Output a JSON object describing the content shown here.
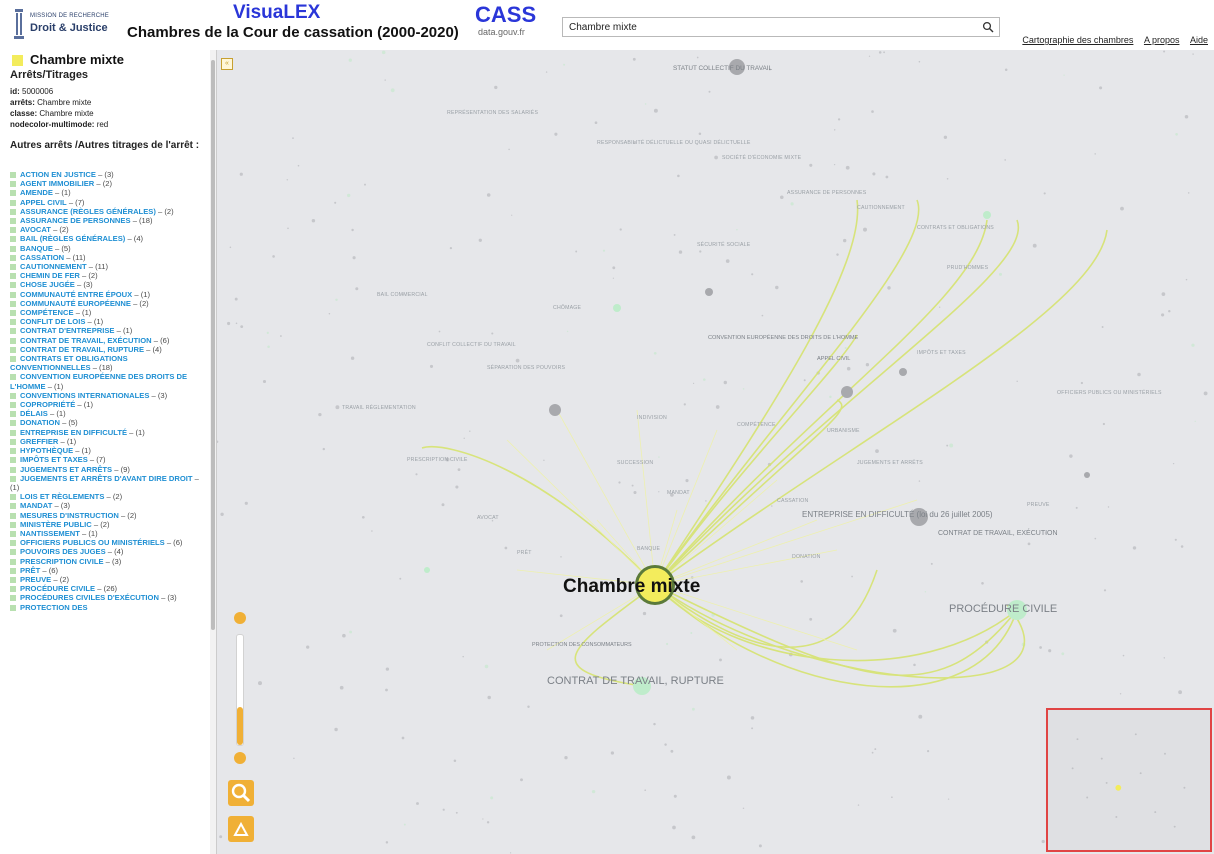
{
  "header": {
    "logo_line1": "MISSION DE RECHERCHE",
    "logo_line2": "Droit & Justice",
    "app_name": "VisuaLEX",
    "app_subtitle": "Chambres de la Cour de cassation (2000-2020)",
    "cass_title": "CASS",
    "cass_sub": "data.gouv.fr",
    "search": {
      "value": "Chambre mixte",
      "placeholder": ""
    },
    "links": [
      "Cartographie des chambres",
      "A propos",
      "Aide"
    ]
  },
  "sidebar": {
    "selected_name": "Chambre mixte",
    "section_title": "Arrêts/Titrages",
    "meta": [
      {
        "key": "id:",
        "value": "5000006"
      },
      {
        "key": "arrêts:",
        "value": "Chambre mixte"
      },
      {
        "key": "classe:",
        "value": "Chambre mixte"
      },
      {
        "key": "nodecolor-multimode:",
        "value": "red"
      }
    ],
    "other_title": "Autres arrêts /Autres titrages de l'arrêt :",
    "items": [
      {
        "label": "ACTION EN JUSTICE",
        "count": "– (3)"
      },
      {
        "label": "AGENT IMMOBILIER",
        "count": "– (2)"
      },
      {
        "label": "AMENDE",
        "count": "– (1)"
      },
      {
        "label": "APPEL CIVIL",
        "count": "– (7)"
      },
      {
        "label": "ASSURANCE (RÈGLES GÉNÉRALES)",
        "count": "– (2)"
      },
      {
        "label": "ASSURANCE DE PERSONNES",
        "count": "– (18)"
      },
      {
        "label": "AVOCAT",
        "count": "– (2)"
      },
      {
        "label": "BAIL (RÈGLES GÉNÉRALES)",
        "count": "– (4)"
      },
      {
        "label": "BANQUE",
        "count": "– (5)"
      },
      {
        "label": "CASSATION",
        "count": "– (11)"
      },
      {
        "label": "CAUTIONNEMENT",
        "count": "– (11)"
      },
      {
        "label": "CHEMIN DE FER",
        "count": "– (2)"
      },
      {
        "label": "CHOSE JUGÉE",
        "count": "– (3)"
      },
      {
        "label": "COMMUNAUTÉ ENTRE ÉPOUX",
        "count": "– (1)"
      },
      {
        "label": "COMMUNAUTÉ EUROPÉENNE",
        "count": "– (2)"
      },
      {
        "label": "COMPÉTENCE",
        "count": "– (1)"
      },
      {
        "label": "CONFLIT DE LOIS",
        "count": "– (1)"
      },
      {
        "label": "CONTRAT D'ENTREPRISE",
        "count": "– (1)"
      },
      {
        "label": "CONTRAT DE TRAVAIL, EXÉCUTION",
        "count": "– (6)"
      },
      {
        "label": "CONTRAT DE TRAVAIL, RUPTURE",
        "count": "– (4)"
      },
      {
        "label": "CONTRATS ET OBLIGATIONS CONVENTIONNELLES",
        "count": "– (18)"
      },
      {
        "label": "CONVENTION EUROPÉENNE DES DROITS DE L'HOMME",
        "count": "– (1)"
      },
      {
        "label": "CONVENTIONS INTERNATIONALES",
        "count": "– (3)"
      },
      {
        "label": "COPROPRIÉTÉ",
        "count": "– (1)"
      },
      {
        "label": "DÉLAIS",
        "count": "– (1)"
      },
      {
        "label": "DONATION",
        "count": "– (5)"
      },
      {
        "label": "ENTREPRISE EN DIFFICULTÉ",
        "count": "– (1)"
      },
      {
        "label": "GREFFIER",
        "count": "– (1)"
      },
      {
        "label": "HYPOTHÈQUE",
        "count": "– (1)"
      },
      {
        "label": "IMPÔTS ET TAXES",
        "count": "– (7)"
      },
      {
        "label": "JUGEMENTS ET ARRÊTS",
        "count": "– (9)"
      },
      {
        "label": "JUGEMENTS ET ARRÊTS D'AVANT DIRE DROIT",
        "count": "– (1)"
      },
      {
        "label": "LOIS ET RÈGLEMENTS",
        "count": "– (2)"
      },
      {
        "label": "MANDAT",
        "count": "– (3)"
      },
      {
        "label": "MESURES D'INSTRUCTION",
        "count": "– (2)"
      },
      {
        "label": "MINISTÈRE PUBLIC",
        "count": "– (2)"
      },
      {
        "label": "NANTISSEMENT",
        "count": "– (1)"
      },
      {
        "label": "OFFICIERS PUBLICS OU MINISTÉRIELS",
        "count": "– (6)"
      },
      {
        "label": "POUVOIRS DES JUGES",
        "count": "– (4)"
      },
      {
        "label": "PRESCRIPTION CIVILE",
        "count": "– (3)"
      },
      {
        "label": "PRÊT",
        "count": "– (6)"
      },
      {
        "label": "PREUVE",
        "count": "– (2)"
      },
      {
        "label": "PROCÉDURE CIVILE",
        "count": "– (26)"
      },
      {
        "label": "PROCÉDURES CIVILES D'EXÉCUTION",
        "count": "– (3)"
      },
      {
        "label": "PROTECTION DES",
        "count": ""
      }
    ]
  },
  "graph": {
    "focus_label": "Chambre mixte",
    "collapse_toggle": "«",
    "big_labels": [
      "PROCÉDURE CIVILE",
      "CONTRAT DE TRAVAIL, RUPTURE",
      "CONTRAT DE TRAVAIL, EXÉCUTION",
      "STATUT COLLECTIF DU TRAVAIL",
      "CONVENTION EUROPÉENNE DES DROITS DE L'HOMME",
      "APPEL CIVIL",
      "PROTECTION DES CONSOMMATEURS"
    ],
    "entreprise_label": "ENTREPRISE EN DIFFICULTÉ (loi du 26 juillet 2005)",
    "small_labels": [
      "REPRÉSENTATION DES SALARIÉS",
      "RESPONSABILITÉ DÉLICTUELLE OU QUASI DÉLICTUELLE",
      "SOCIÉTÉ D'ÉCONOMIE MIXTE",
      "ASSURANCE DE PERSONNES",
      "CAUTIONNEMENT",
      "CONTRATS ET OBLIGATIONS",
      "PRUD'HOMMES",
      "SÉCURITÉ SOCIALE",
      "BAIL COMMERCIAL",
      "CHÔMAGE",
      "CONFLIT COLLECTIF DU TRAVAIL",
      "SÉPARATION DES POUVOIRS",
      "TRAVAIL RÉGLEMENTATION",
      "INDIVISION",
      "COMPÉTENCE",
      "URBANISME",
      "PRESCRIPTION CIVILE",
      "SUCCESSION",
      "MANDAT",
      "CASSATION",
      "JUGEMENTS ET ARRÊTS",
      "PREUVE",
      "AVOCAT",
      "PRÊT",
      "BANQUE",
      "DONATION",
      "IMPÔTS ET TAXES",
      "OFFICIERS PUBLICS OU MINISTÉRIELS"
    ]
  },
  "zoom": {
    "level": 0.35
  },
  "colors": {
    "focus_node": "#f3ec5c",
    "edge": "#d6e36f",
    "link": "#1f8fd3",
    "accent": "#f0b036",
    "title_blue": "#2a36d8"
  }
}
